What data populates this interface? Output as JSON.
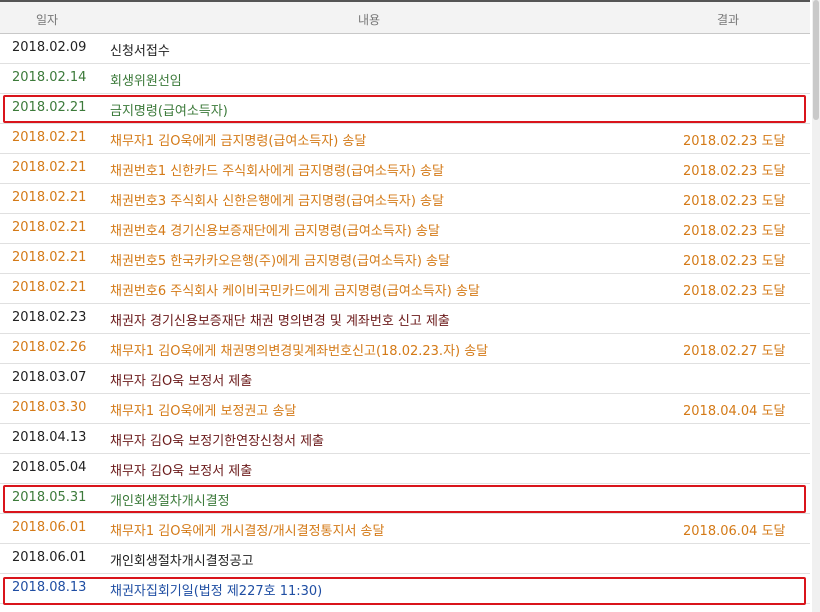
{
  "header": {
    "date": "일자",
    "content": "내용",
    "result": "결과"
  },
  "rows": [
    {
      "date": "2018.02.09",
      "content": "신청서접수",
      "result": ""
    },
    {
      "date": "2018.02.14",
      "content": "회생위원선임",
      "result": ""
    },
    {
      "date": "2018.02.21",
      "content": "금지명령(급여소득자)",
      "result": ""
    },
    {
      "date": "2018.02.21",
      "content": "채무자1 김O욱에게 금지명령(급여소득자) 송달",
      "result": "2018.02.23 도달"
    },
    {
      "date": "2018.02.21",
      "content": "채권번호1 신한카드 주식회사에게 금지명령(급여소득자) 송달",
      "result": "2018.02.23 도달"
    },
    {
      "date": "2018.02.21",
      "content": "채권번호3 주식회사 신한은행에게 금지명령(급여소득자) 송달",
      "result": "2018.02.23 도달"
    },
    {
      "date": "2018.02.21",
      "content": "채권번호4 경기신용보증재단에게 금지명령(급여소득자) 송달",
      "result": "2018.02.23 도달"
    },
    {
      "date": "2018.02.21",
      "content": "채권번호5 한국카카오은행(주)에게 금지명령(급여소득자) 송달",
      "result": "2018.02.23 도달"
    },
    {
      "date": "2018.02.21",
      "content": "채권번호6 주식회사 케이비국민카드에게 금지명령(급여소득자) 송달",
      "result": "2018.02.23 도달"
    },
    {
      "date": "2018.02.23",
      "content": "채권자 경기신용보증재단 채권 명의변경 및 계좌번호 신고 제출",
      "result": ""
    },
    {
      "date": "2018.02.26",
      "content": "채무자1 김O욱에게 채권명의변경및계좌번호신고(18.02.23.자) 송달",
      "result": "2018.02.27 도달"
    },
    {
      "date": "2018.03.07",
      "content": "채무자 김O욱 보정서 제출",
      "result": ""
    },
    {
      "date": "2018.03.30",
      "content": "채무자1 김O욱에게 보정권고 송달",
      "result": "2018.04.04 도달"
    },
    {
      "date": "2018.04.13",
      "content": "채무자 김O욱 보정기한연장신청서 제출",
      "result": ""
    },
    {
      "date": "2018.05.04",
      "content": "채무자 김O욱 보정서 제출",
      "result": ""
    },
    {
      "date": "2018.05.31",
      "content": "개인회생절차개시결정",
      "result": ""
    },
    {
      "date": "2018.06.01",
      "content": "채무자1 김O욱에게 개시결정/개시결정통지서 송달",
      "result": "2018.06.04 도달"
    },
    {
      "date": "2018.06.01",
      "content": "개인회생절차개시결정공고",
      "result": ""
    },
    {
      "date": "2018.08.13",
      "content": "채권자집회기일(법정 제227호 11:30)",
      "result": ""
    }
  ],
  "colors": {
    "highlight": "#d9141b",
    "orange": "#d47a17",
    "green": "#3c7a3a",
    "maroon": "#6b1a1a",
    "blue": "#1f4ea3"
  }
}
